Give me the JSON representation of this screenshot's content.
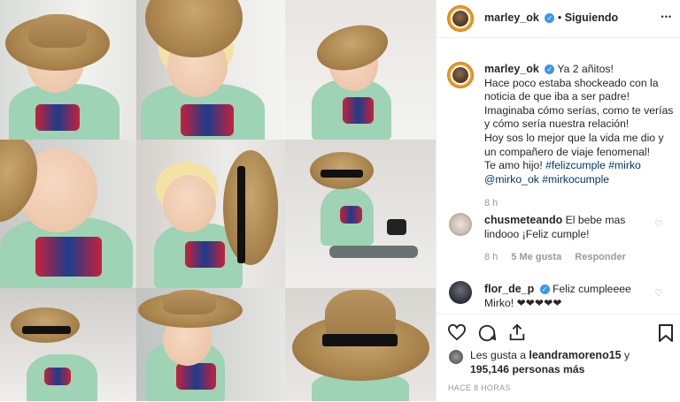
{
  "header": {
    "username": "marley_ok",
    "dot": "•",
    "following": "Siguiendo",
    "more": "•••"
  },
  "caption": {
    "username": "marley_ok",
    "lines": [
      "Ya 2 añitos!",
      "Hace poco estaba shockeado con la",
      "noticia de que iba a ser padre!",
      "Imaginaba cómo serías, como te verías",
      "y cómo sería nuestra relación!",
      "Hoy sos lo mejor que la vida me dio y",
      "un compañero de viaje fenomenal!",
      "Te amo hijo!"
    ],
    "tags": [
      "#felizcumple",
      "#mirko",
      "@mirko_ok",
      "#mirkocumple"
    ],
    "time": "8 h"
  },
  "comments": [
    {
      "username": "chusmeteando",
      "text_line1": "El bebe mas",
      "text_line2": "lindooo ¡Feliz cumple!",
      "time": "8 h",
      "likes": "5 Me gusta",
      "reply": "Responder"
    },
    {
      "username": "flor_de_p",
      "text_line1": "Feliz cumpleeee",
      "text_line2": "Mirko! ❤❤❤❤❤"
    }
  ],
  "likes": {
    "prefix": "Les gusta a",
    "user": "leandramoreno15",
    "conj": "y",
    "count": "195,146 personas más"
  },
  "timestamp": "HACE 8 HORAS",
  "colors": {
    "link": "#003569",
    "verified": "#3897f0",
    "muted": "#999999"
  }
}
